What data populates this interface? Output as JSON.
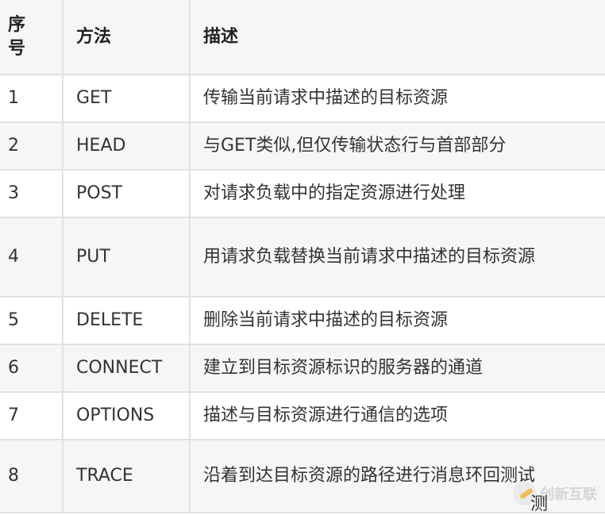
{
  "table": {
    "headers": [
      "序号",
      "方法",
      "描述"
    ],
    "rows": [
      {
        "index": "1",
        "method": "GET",
        "description": "传输当前请求中描述的目标资源"
      },
      {
        "index": "2",
        "method": "HEAD",
        "description": "与GET类似,但仅传输状态行与首部部分"
      },
      {
        "index": "3",
        "method": "POST",
        "description": "对请求负载中的指定资源进行处理"
      },
      {
        "index": "4",
        "method": "PUT",
        "description": "用请求负载替换当前请求中描述的目标资源"
      },
      {
        "index": "5",
        "method": "DELETE",
        "description": "删除当前请求中描述的目标资源"
      },
      {
        "index": "6",
        "method": "CONNECT",
        "description": "建立到目标资源标识的服务器的通道"
      },
      {
        "index": "7",
        "method": "OPTIONS",
        "description": "描述与目标资源进行通信的选项"
      },
      {
        "index": "8",
        "method": "TRACE",
        "description": "沿着到达目标资源的路径进行消息环回测试"
      }
    ]
  },
  "watermark": {
    "text": "创新互联",
    "extra": "测"
  }
}
